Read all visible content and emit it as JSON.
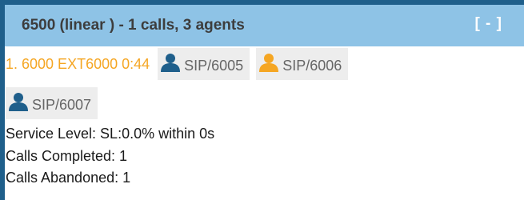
{
  "queue": {
    "title": "6500 (linear ) - 1 calls, 3 agents",
    "collapse_label": "[ - ]",
    "header_color": "#8ec3e6",
    "frame_color": "#1f5f8b"
  },
  "call": {
    "text": "1. 6000 EXT6000 0:44",
    "color": "#f5a623"
  },
  "agents": [
    {
      "label": "SIP/6005",
      "icon": "user-icon",
      "status_color": "#1f5f8b"
    },
    {
      "label": "SIP/6006",
      "icon": "user-icon",
      "status_color": "#f5a623"
    },
    {
      "label": "SIP/6007",
      "icon": "user-icon",
      "status_color": "#1f5f8b"
    }
  ],
  "stats": {
    "service_level": "Service Level: SL:0.0% within 0s",
    "calls_completed": "Calls Completed: 1",
    "calls_abandoned": "Calls Abandoned: 1"
  }
}
